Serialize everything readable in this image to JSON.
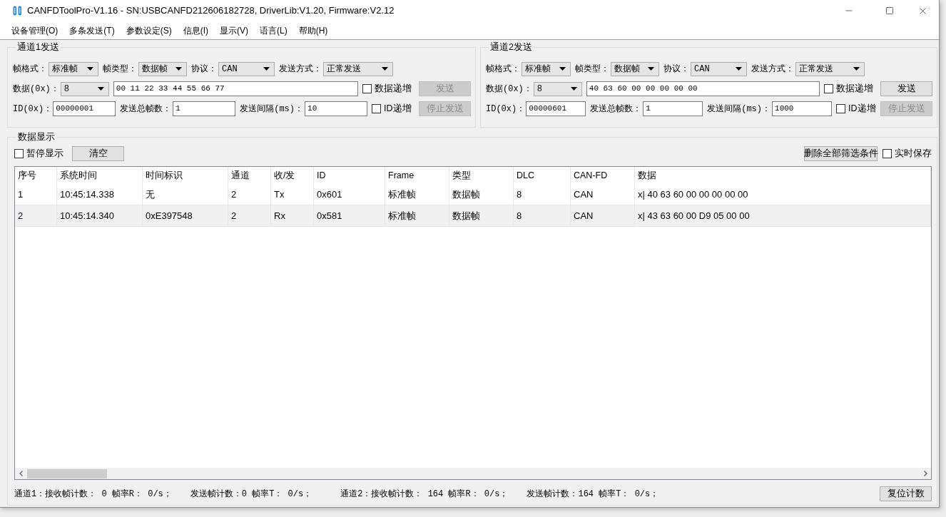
{
  "window": {
    "title": "CANFDToolPro-V1.16 - SN:USBCANFD212606182728, DriverLib:V1.20, Firmware:V2.12"
  },
  "menu": [
    {
      "label": "设备管理(O)"
    },
    {
      "label": "多条发送(T)"
    },
    {
      "label": "参数设定(S)"
    },
    {
      "label": "信息(I)"
    },
    {
      "label": "显示(V)"
    },
    {
      "label": "语言(L)"
    },
    {
      "label": "帮助(H)"
    }
  ],
  "channels": [
    {
      "title": "通道1发送",
      "frame_format": {
        "label": "帧格式：",
        "value": "标准帧"
      },
      "frame_type": {
        "label": "帧类型：",
        "value": "数据帧"
      },
      "protocol": {
        "label": "协议：",
        "value": "CAN"
      },
      "send_mode": {
        "label": "发送方式：",
        "value": "正常发送"
      },
      "data_length": {
        "label": "数据(0x)：",
        "value": "8"
      },
      "data": {
        "value": "00 11 22 33 44 55 66 77"
      },
      "data_increment": {
        "label": "数据递增",
        "checked": false
      },
      "send_button": {
        "label": "发送",
        "disabled": true
      },
      "id": {
        "label": "ID(0x)：",
        "value": "00000001"
      },
      "total_frames": {
        "label": "发送总帧数：",
        "value": "1"
      },
      "interval": {
        "label": "发送间隔(ms)：",
        "value": "10"
      },
      "id_increment": {
        "label": "ID递增",
        "checked": false
      },
      "stop_button": {
        "label": "停止发送",
        "disabled": true
      }
    },
    {
      "title": "通道2发送",
      "frame_format": {
        "label": "帧格式：",
        "value": "标准帧"
      },
      "frame_type": {
        "label": "帧类型：",
        "value": "数据帧"
      },
      "protocol": {
        "label": "协议：",
        "value": "CAN"
      },
      "send_mode": {
        "label": "发送方式：",
        "value": "正常发送"
      },
      "data_length": {
        "label": "数据(0x)：",
        "value": "8"
      },
      "data": {
        "value": "40 63 60 00 00 00 00 00"
      },
      "data_increment": {
        "label": "数据递增",
        "checked": false
      },
      "send_button": {
        "label": "发送",
        "disabled": false
      },
      "id": {
        "label": "ID(0x)：",
        "value": "00000601"
      },
      "total_frames": {
        "label": "发送总帧数：",
        "value": "1"
      },
      "interval": {
        "label": "发送间隔(ms)：",
        "value": "1000"
      },
      "id_increment": {
        "label": "ID递增",
        "checked": false
      },
      "stop_button": {
        "label": "停止发送",
        "disabled": true
      }
    }
  ],
  "data_display": {
    "title": "数据显示",
    "pause": {
      "label": "暂停显示",
      "checked": false
    },
    "clear_button": "清空",
    "delete_filters_button": "删除全部筛选条件",
    "realtime_save": {
      "label": "实时保存",
      "checked": false
    },
    "table": {
      "columns": [
        "序号",
        "系统时间",
        "时间标识",
        "通道",
        "收/发",
        "ID",
        "Frame",
        "类型",
        "DLC",
        "CAN-FD",
        "数据"
      ],
      "rows": [
        {
          "selected": false,
          "cells": [
            "1",
            "10:45:14.338",
            "无",
            "2",
            "Tx",
            "0x601",
            "标准帧",
            "数据帧",
            "8",
            "CAN",
            "x| 40 63 60 00 00 00 00 00"
          ]
        },
        {
          "selected": true,
          "cells": [
            "2",
            "10:45:14.340",
            "0xE397548",
            "2",
            "Rx",
            "0x581",
            "标准帧",
            "数据帧",
            "8",
            "CAN",
            "x| 43 63 60 00 D9 05 00 00"
          ]
        }
      ]
    }
  },
  "status_bar": {
    "items": [
      "通道1：接收帧计数： 0 帧率R： 0/s；",
      "发送帧计数：0 帧率T： 0/s；",
      "通道2：接收帧计数： 164 帧率R： 0/s；",
      "发送帧计数：164 帧率T： 0/s；"
    ],
    "reset_button": "复位计数"
  }
}
